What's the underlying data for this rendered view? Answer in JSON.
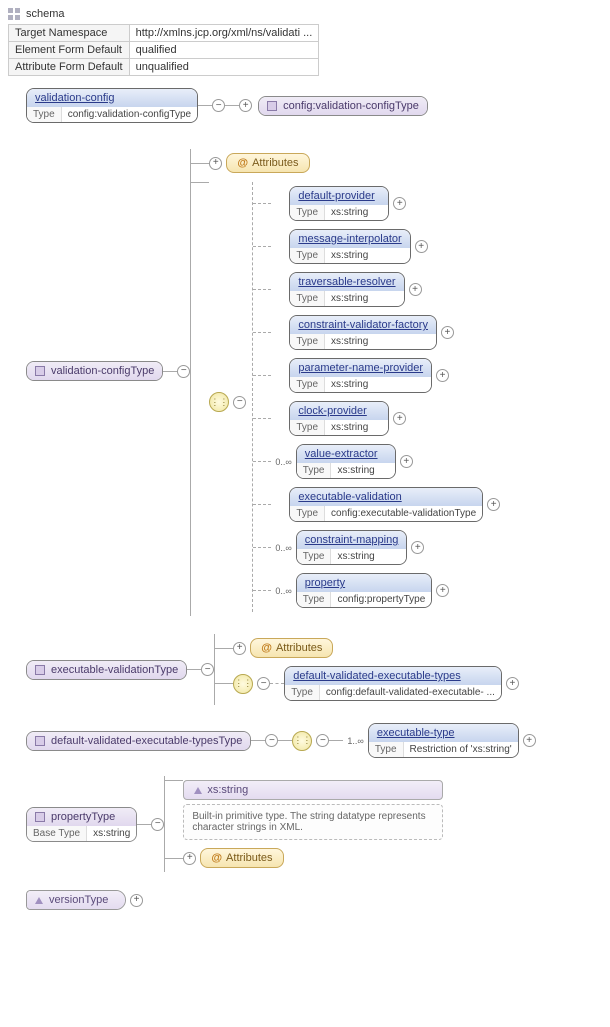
{
  "schema_label": "schema",
  "info": {
    "ns_label": "Target Namespace",
    "ns_value": "http://xmlns.jcp.org/xml/ns/validati ...",
    "efd_label": "Element Form Default",
    "efd_value": "qualified",
    "afd_label": "Attribute Form Default",
    "afd_value": "unqualified"
  },
  "labels": {
    "type": "Type",
    "base_type": "Base Type",
    "attributes": "Attributes"
  },
  "root": {
    "name": "validation-config",
    "type": "config:validation-configType",
    "type_ref": "config:validation-configType"
  },
  "vct": {
    "name": "validation-configType",
    "children": [
      {
        "name": "default-provider",
        "type": "xs:string"
      },
      {
        "name": "message-interpolator",
        "type": "xs:string"
      },
      {
        "name": "traversable-resolver",
        "type": "xs:string"
      },
      {
        "name": "constraint-validator-factory",
        "type": "xs:string"
      },
      {
        "name": "parameter-name-provider",
        "type": "xs:string"
      },
      {
        "name": "clock-provider",
        "type": "xs:string"
      },
      {
        "name": "value-extractor",
        "type": "xs:string",
        "occ": "0..∞"
      },
      {
        "name": "executable-validation",
        "type": "config:executable-validationType"
      },
      {
        "name": "constraint-mapping",
        "type": "xs:string",
        "occ": "0..∞"
      },
      {
        "name": "property",
        "type": "config:propertyType",
        "occ": "0..∞"
      }
    ]
  },
  "evt": {
    "name": "executable-validationType",
    "child": {
      "name": "default-validated-executable-types",
      "type": "config:default-validated-executable- ..."
    }
  },
  "dvet": {
    "name": "default-validated-executable-typesType",
    "child": {
      "name": "executable-type",
      "type": "Restriction of 'xs:string'",
      "occ": "1..∞"
    }
  },
  "pt": {
    "name": "propertyType",
    "base": "xs:string",
    "ext": "xs:string",
    "doc": "Built-in primitive type. The string datatype represents character strings in XML."
  },
  "vt": {
    "name": "versionType"
  }
}
